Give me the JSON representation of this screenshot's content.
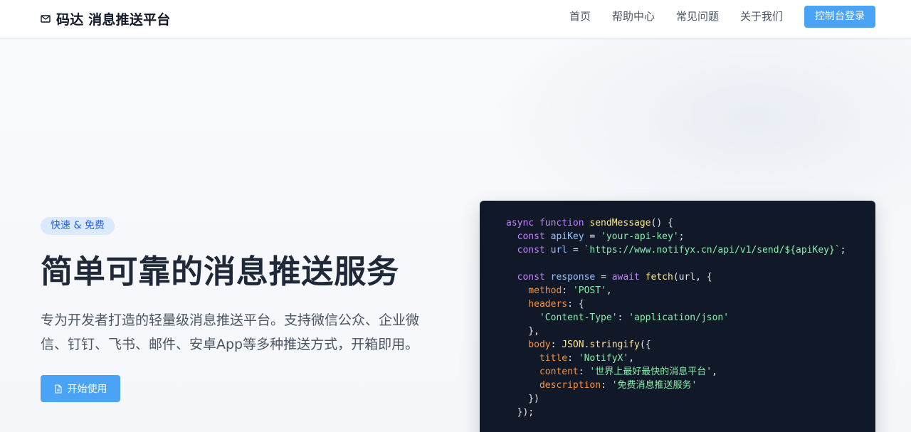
{
  "header": {
    "brand": {
      "icon": "mail-icon",
      "text": "码达 消息推送平台"
    },
    "nav": [
      {
        "label": "首页",
        "name": "nav-home"
      },
      {
        "label": "帮助中心",
        "name": "nav-help-center"
      },
      {
        "label": "常见问题",
        "name": "nav-faq"
      },
      {
        "label": "关于我们",
        "name": "nav-about"
      }
    ],
    "login_button": "控制台登录"
  },
  "hero": {
    "badge": "快速 & 免费",
    "title": "简单可靠的消息推送服务",
    "description": "专为开发者打造的轻量级消息推送平台。支持微信公众、企业微信、钉钉、飞书、邮件、安卓App等多种推送方式，开箱即用。",
    "cta": {
      "icon": "document-icon",
      "label": "开始使用"
    }
  },
  "code_sample": {
    "lines": [
      [
        {
          "t": "async function ",
          "k": "keyword"
        },
        {
          "t": "sendMessage",
          "k": "function"
        },
        {
          "t": "() {",
          "k": "plain"
        }
      ],
      [
        {
          "t": "  const ",
          "k": "keyword"
        },
        {
          "t": "apiKey",
          "k": "variable"
        },
        {
          "t": " = ",
          "k": "plain"
        },
        {
          "t": "'your-api-key'",
          "k": "string"
        },
        {
          "t": ";",
          "k": "plain"
        }
      ],
      [
        {
          "t": "  const ",
          "k": "keyword"
        },
        {
          "t": "url",
          "k": "variable"
        },
        {
          "t": " = ",
          "k": "plain"
        },
        {
          "t": "`https://www.notifyx.cn/api/v1/send/${apiKey}`",
          "k": "string"
        },
        {
          "t": ";",
          "k": "plain"
        }
      ],
      [
        {
          "t": "",
          "k": "plain"
        }
      ],
      [
        {
          "t": "  const ",
          "k": "keyword"
        },
        {
          "t": "response",
          "k": "variable"
        },
        {
          "t": " = ",
          "k": "plain"
        },
        {
          "t": "await ",
          "k": "keyword"
        },
        {
          "t": "fetch",
          "k": "function"
        },
        {
          "t": "(url, {",
          "k": "plain"
        }
      ],
      [
        {
          "t": "    method",
          "k": "property"
        },
        {
          "t": ": ",
          "k": "plain"
        },
        {
          "t": "'POST'",
          "k": "string"
        },
        {
          "t": ",",
          "k": "plain"
        }
      ],
      [
        {
          "t": "    headers",
          "k": "property"
        },
        {
          "t": ": {",
          "k": "plain"
        }
      ],
      [
        {
          "t": "      'Content-Type'",
          "k": "string"
        },
        {
          "t": ": ",
          "k": "plain"
        },
        {
          "t": "'application/json'",
          "k": "string"
        }
      ],
      [
        {
          "t": "    },",
          "k": "plain"
        }
      ],
      [
        {
          "t": "    body",
          "k": "property"
        },
        {
          "t": ": ",
          "k": "plain"
        },
        {
          "t": "JSON",
          "k": "function"
        },
        {
          "t": ".",
          "k": "plain"
        },
        {
          "t": "stringify",
          "k": "function"
        },
        {
          "t": "({",
          "k": "plain"
        }
      ],
      [
        {
          "t": "      title",
          "k": "property"
        },
        {
          "t": ": ",
          "k": "plain"
        },
        {
          "t": "'NotifyX'",
          "k": "string"
        },
        {
          "t": ",",
          "k": "plain"
        }
      ],
      [
        {
          "t": "      content",
          "k": "property"
        },
        {
          "t": ": ",
          "k": "plain"
        },
        {
          "t": "'世界上最好最快的消息平台'",
          "k": "string"
        },
        {
          "t": ",",
          "k": "plain"
        }
      ],
      [
        {
          "t": "      description",
          "k": "property"
        },
        {
          "t": ": ",
          "k": "plain"
        },
        {
          "t": "'免费消息推送服务'",
          "k": "string"
        }
      ],
      [
        {
          "t": "    })",
          "k": "plain"
        }
      ],
      [
        {
          "t": "  });",
          "k": "plain"
        }
      ]
    ]
  }
}
